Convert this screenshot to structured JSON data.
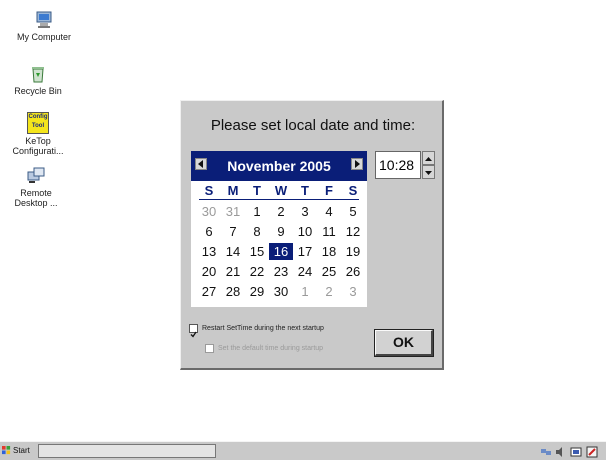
{
  "desktop": {
    "icons": [
      {
        "label": "My Computer"
      },
      {
        "label": "Recycle Bin"
      },
      {
        "label": "KeTop Configurati...",
        "badge_line1": "Config",
        "badge_line2": "Tool"
      },
      {
        "label": "Remote Desktop ..."
      }
    ]
  },
  "dialog": {
    "title": "Please set local date and time:",
    "calendar": {
      "month_label": "November 2005",
      "weekdays": [
        "S",
        "M",
        "T",
        "W",
        "T",
        "F",
        "S"
      ],
      "weeks": [
        [
          "30",
          "31",
          "1",
          "2",
          "3",
          "4",
          "5"
        ],
        [
          "6",
          "7",
          "8",
          "9",
          "10",
          "11",
          "12"
        ],
        [
          "13",
          "14",
          "15",
          "16",
          "17",
          "18",
          "19"
        ],
        [
          "20",
          "21",
          "22",
          "23",
          "24",
          "25",
          "26"
        ],
        [
          "27",
          "28",
          "29",
          "30",
          "1",
          "2",
          "3"
        ]
      ],
      "selected_day": "16"
    },
    "time_value": "10:28",
    "restart_checkbox": {
      "label": "Restart SetTime during the next startup",
      "checked": true
    },
    "default_checkbox": {
      "label": "Set the default time during startup",
      "checked": false,
      "enabled": false
    },
    "ok_label": "OK"
  },
  "taskbar": {
    "start_label": "Start"
  },
  "colors": {
    "calendar_header": "#0a1e78",
    "dialog_bg": "#c9c9c9"
  }
}
